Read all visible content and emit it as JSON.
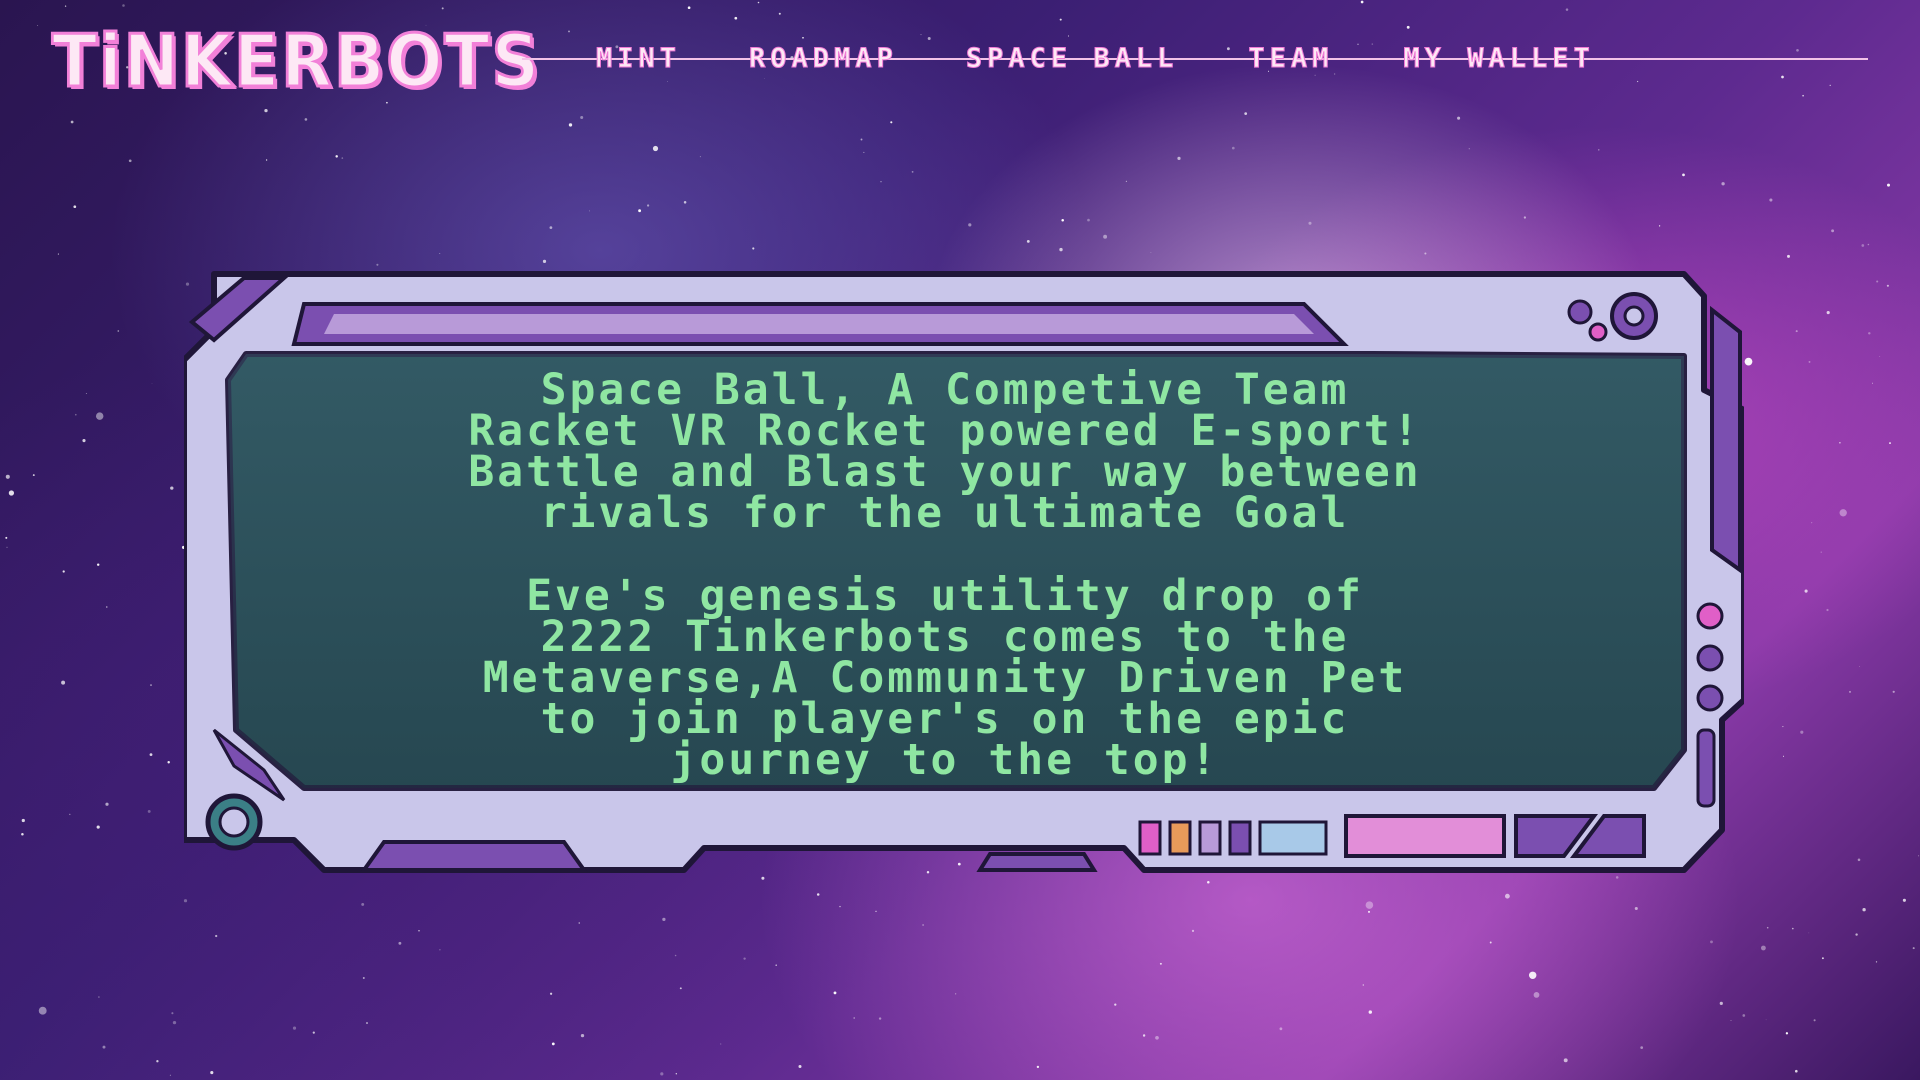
{
  "header": {
    "logo": "TiNKERBOTS",
    "nav": [
      {
        "label": "MINT"
      },
      {
        "label": "ROADMAP"
      },
      {
        "label": "SPACE BALL"
      },
      {
        "label": "TEAM"
      },
      {
        "label": "MY WALLET"
      }
    ]
  },
  "screen": {
    "paragraph1": [
      "Space Ball, A Competive Team",
      "Racket VR Rocket powered E-sport!",
      "Battle and Blast your way between",
      "rivals for the ultimate Goal"
    ],
    "paragraph2": [
      "Eve's genesis utility drop of",
      "2222 Tinkerbots comes to the",
      "Metaverse,A Community Driven Pet",
      "to join player's on the epic",
      "journey to the top!"
    ]
  },
  "colors": {
    "accent_pink": "#f280d8",
    "screen_text": "#8fe6a2",
    "frame": "#c9c6ea",
    "frame_dark": "#7b4fb0"
  }
}
